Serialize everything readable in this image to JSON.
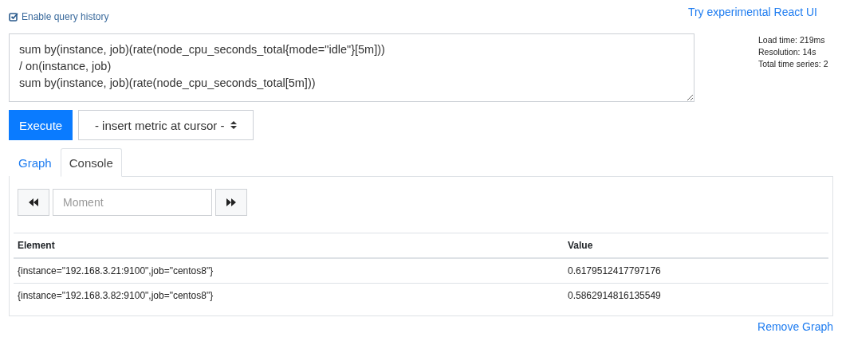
{
  "query_history": {
    "label": "Enable query history",
    "checked": true
  },
  "react_link": "Try experimental React UI",
  "expression": "sum by(instance, job)(rate(node_cpu_seconds_total{mode=\"idle\"}[5m]))\n/ on(instance, job)\nsum by(instance, job)(rate(node_cpu_seconds_total[5m]))",
  "stats": [
    "Load time: 219ms",
    "Resolution: 14s",
    "Total time series: 2"
  ],
  "execute_button": "Execute",
  "metric_select": "- insert metric at cursor -",
  "tabs": [
    {
      "label": "Graph",
      "selected": false
    },
    {
      "label": "Console",
      "selected": true
    }
  ],
  "moment": {
    "placeholder": "Moment"
  },
  "table": {
    "columns": [
      "Element",
      "Value"
    ],
    "rows": [
      [
        "{instance=\"192.168.3.21:9100\",job=\"centos8\"}",
        "0.6179512417797176"
      ],
      [
        "{instance=\"192.168.3.82:9100\",job=\"centos8\"}",
        "0.5862914816135549"
      ]
    ]
  },
  "remove_link": "Remove Graph"
}
